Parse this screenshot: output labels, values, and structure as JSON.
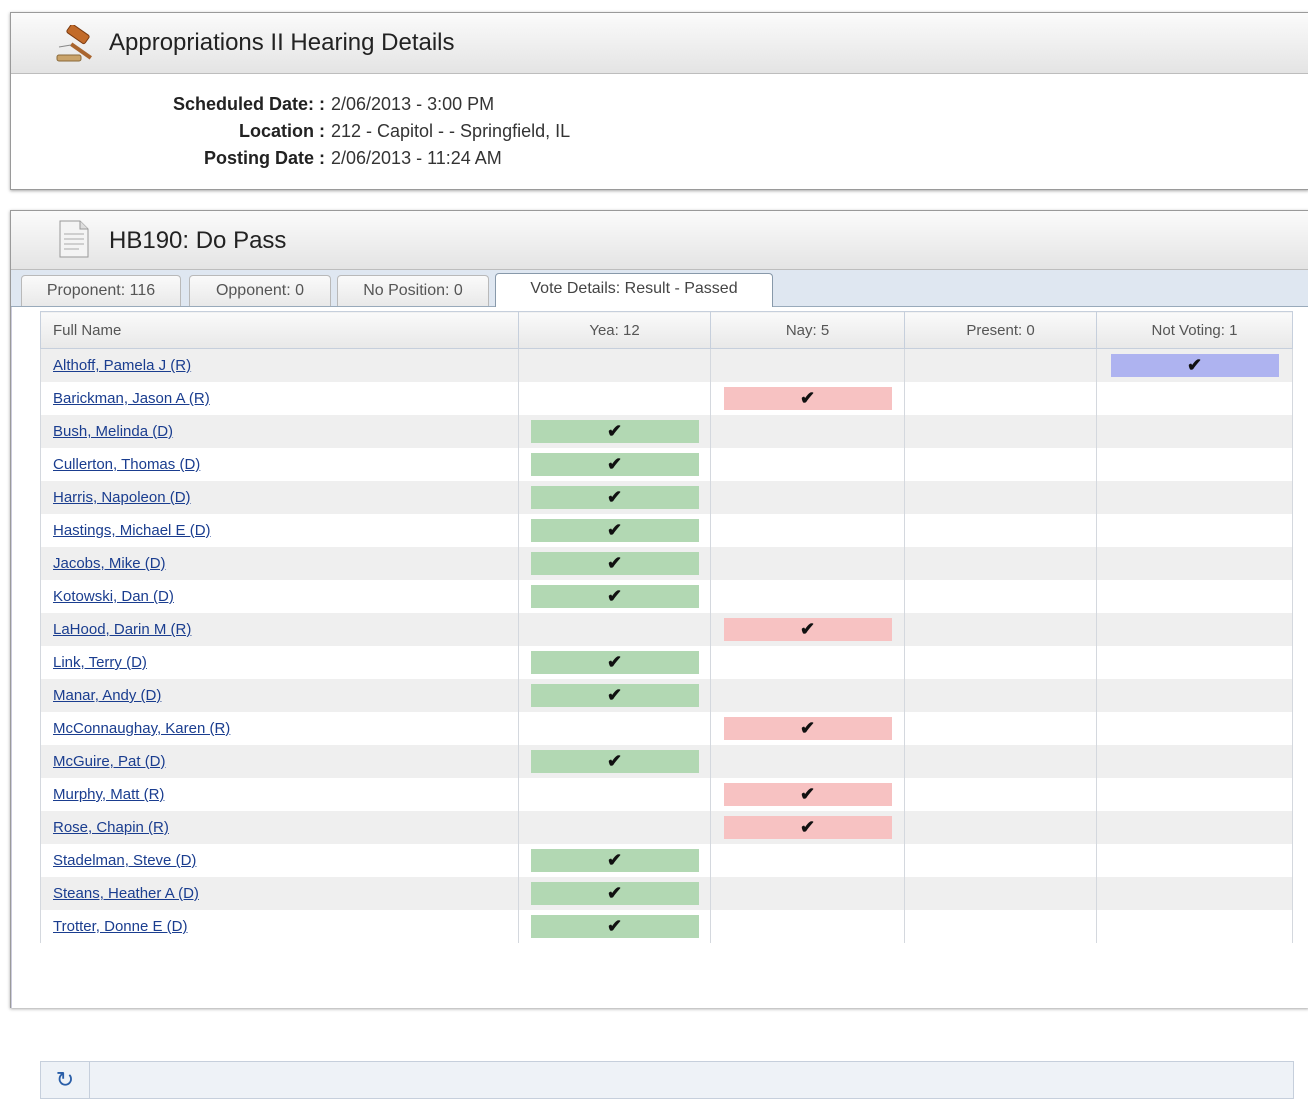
{
  "hearing": {
    "title": "Appropriations II Hearing Details",
    "details": [
      {
        "label": "Scheduled Date: :",
        "value": "2/06/2013 - 3:00 PM"
      },
      {
        "label": "Location :",
        "value": "212 - Capitol - - Springfield, IL"
      },
      {
        "label": "Posting Date :",
        "value": "2/06/2013 - 11:24 AM"
      }
    ]
  },
  "bill": {
    "title": "HB190: Do Pass",
    "tabs": [
      {
        "label": "Proponent: 116"
      },
      {
        "label": "Opponent: 0"
      },
      {
        "label": "No Position: 0"
      },
      {
        "label": "Vote Details: Result - Passed"
      }
    ],
    "columns": [
      "Full Name",
      "Yea: 12",
      "Nay: 5",
      "Present: 0",
      "Not Voting: 1"
    ],
    "checkmark": "✔",
    "rows": [
      {
        "name": "Althoff, Pamela J (R)",
        "vote": "nv"
      },
      {
        "name": "Barickman, Jason A (R)",
        "vote": "nay"
      },
      {
        "name": "Bush, Melinda (D)",
        "vote": "yea"
      },
      {
        "name": "Cullerton, Thomas (D)",
        "vote": "yea"
      },
      {
        "name": "Harris, Napoleon (D)",
        "vote": "yea"
      },
      {
        "name": "Hastings, Michael E (D)",
        "vote": "yea"
      },
      {
        "name": "Jacobs, Mike (D)",
        "vote": "yea"
      },
      {
        "name": "Kotowski, Dan (D)",
        "vote": "yea"
      },
      {
        "name": "LaHood, Darin M (R)",
        "vote": "nay"
      },
      {
        "name": "Link, Terry (D)",
        "vote": "yea"
      },
      {
        "name": "Manar, Andy (D)",
        "vote": "yea"
      },
      {
        "name": "McConnaughay, Karen (R)",
        "vote": "nay"
      },
      {
        "name": "McGuire, Pat (D)",
        "vote": "yea"
      },
      {
        "name": "Murphy, Matt (R)",
        "vote": "nay"
      },
      {
        "name": "Rose, Chapin (R)",
        "vote": "nay"
      },
      {
        "name": "Stadelman, Steve (D)",
        "vote": "yea"
      },
      {
        "name": "Steans, Heather A (D)",
        "vote": "yea"
      },
      {
        "name": "Trotter, Donne E (D)",
        "vote": "yea"
      }
    ]
  },
  "icons": {
    "header1": "gavel-icon",
    "header2": "document-icon",
    "footer": "refresh-icon"
  },
  "colors": {
    "yea": "#b2d8b3",
    "nay": "#f7c2c2",
    "not_voting": "#aeb3f0",
    "link": "#1a3d8f"
  }
}
